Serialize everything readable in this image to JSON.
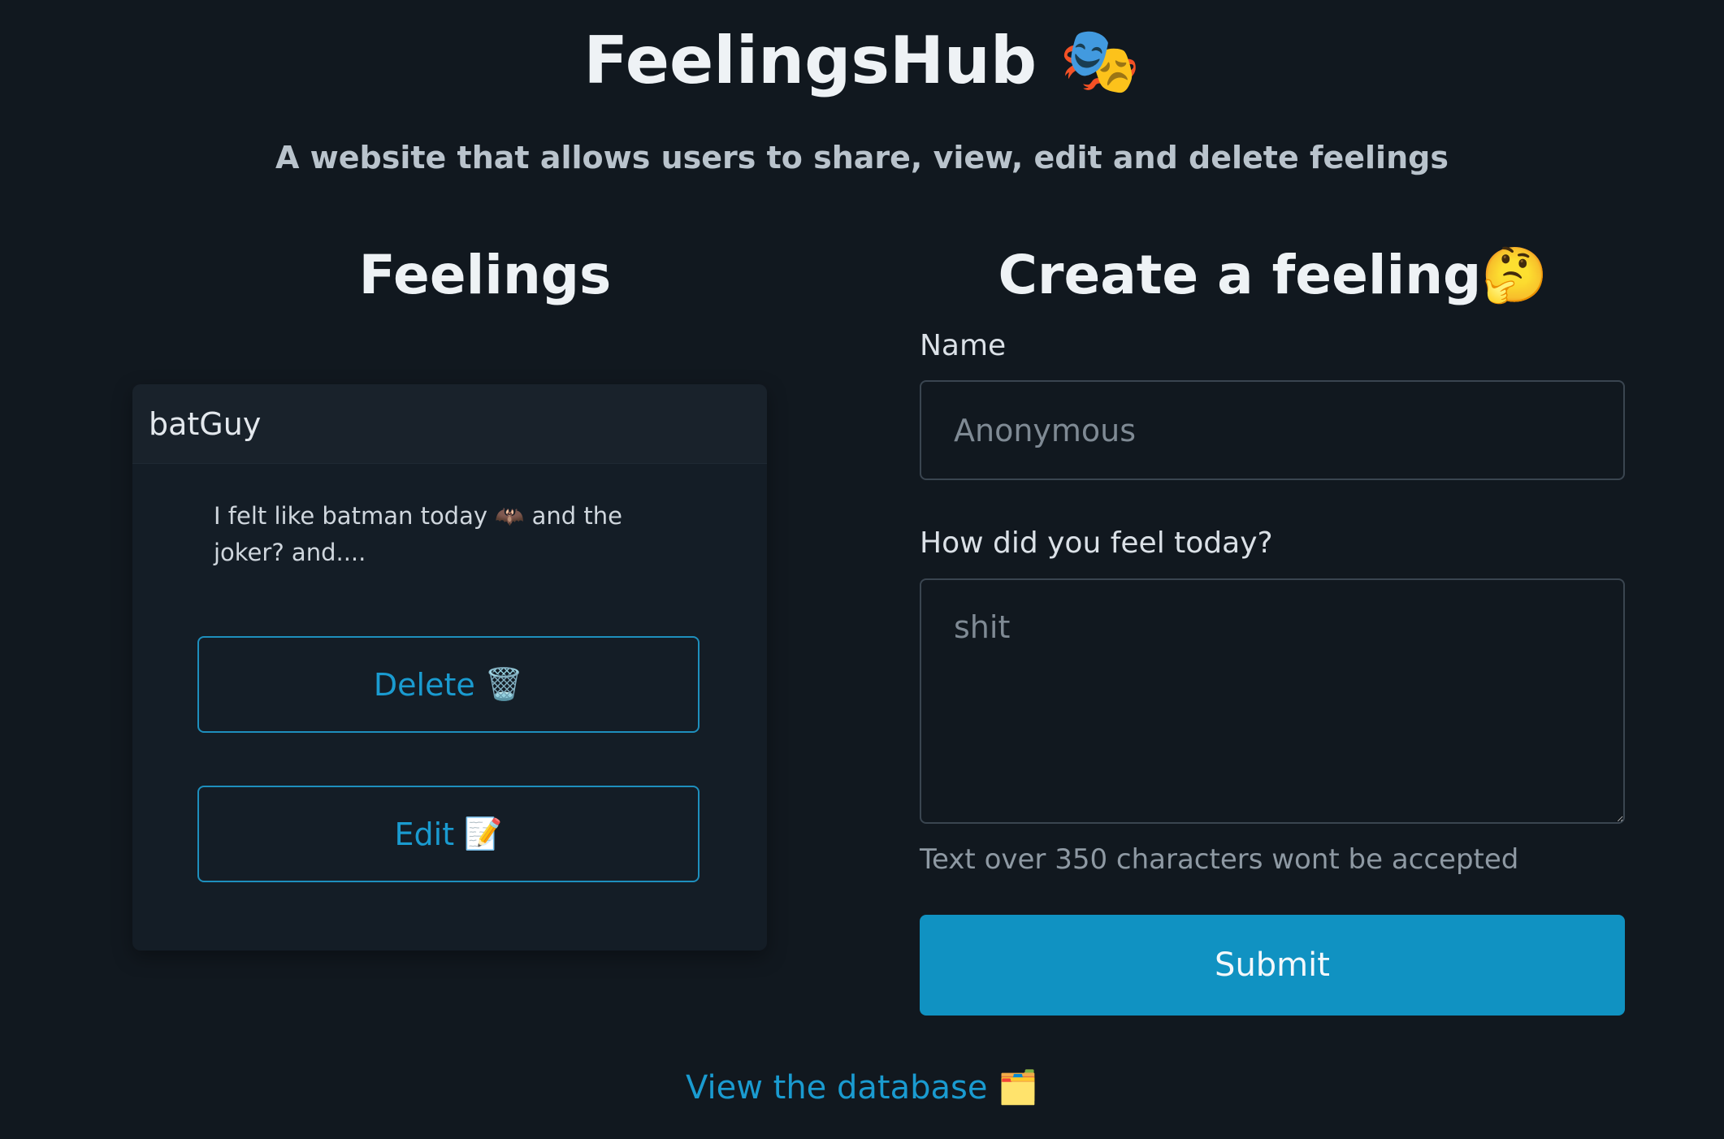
{
  "header": {
    "title": "FeelingsHub",
    "title_icon": "🎭",
    "subtitle": "A website that allows users to share, view, edit and delete feelings"
  },
  "feelings": {
    "heading": "Feelings",
    "cards": [
      {
        "author": "batGuy",
        "text": "I felt like batman today 🦇 and the joker? and....",
        "delete_label": "Delete",
        "delete_icon": "🗑️",
        "edit_label": "Edit",
        "edit_icon": "📝"
      }
    ]
  },
  "form": {
    "heading": "Create a feeling",
    "heading_icon": "🤔",
    "name_label": "Name",
    "name_placeholder": "Anonymous",
    "feeling_label": "How did you feel today?",
    "feeling_placeholder": "shit",
    "help_text": "Text over 350 characters wont be accepted",
    "submit_label": "Submit"
  },
  "footer": {
    "link_label": "View the database",
    "link_icon": "🗂️"
  },
  "colors": {
    "background": "#11181f",
    "accent": "#1092c2",
    "card": "#141d26"
  }
}
